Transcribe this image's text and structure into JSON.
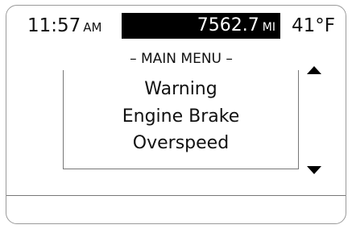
{
  "status_bar": {
    "time": "11:57",
    "time_suffix": "AM",
    "odometer_value": "7562.7",
    "odometer_unit": "MI",
    "temperature": "41°F"
  },
  "menu": {
    "title": "– MAIN MENU –"
  },
  "message": {
    "line1": "Warning",
    "line2": "Engine Brake",
    "line3": "Overspeed"
  },
  "controls": {
    "up_icon": "triangle-up-icon",
    "down_icon": "triangle-down-icon"
  },
  "colors": {
    "background": "#ffffff",
    "text": "#111111",
    "odometer_bar": "#000000",
    "odometer_text": "#ffffff"
  }
}
